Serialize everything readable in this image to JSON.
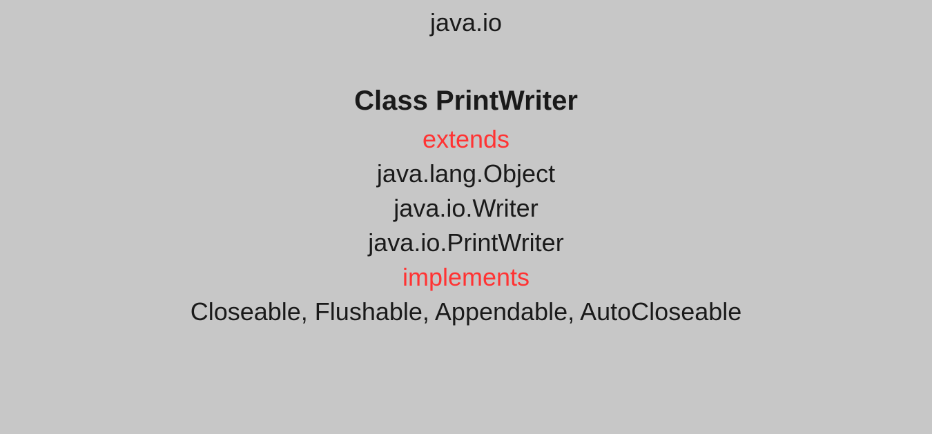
{
  "package": "java.io",
  "classTitle": "Class PrintWriter",
  "extendsKeyword": "extends",
  "hierarchy": {
    "level1": "java.lang.Object",
    "level2": "java.io.Writer",
    "level3": "java.io.PrintWriter"
  },
  "implementsKeyword": "implements",
  "interfaces": "Closeable, Flushable, Appendable, AutoCloseable"
}
